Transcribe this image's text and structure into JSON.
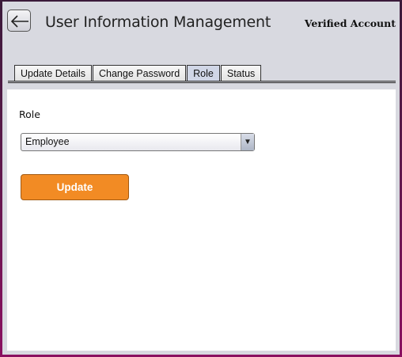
{
  "header": {
    "title": "User Information Management",
    "account_status": "Verified Account",
    "back_icon": "back-arrow-icon"
  },
  "tabs": [
    {
      "label": "Update Details",
      "active": false
    },
    {
      "label": "Change Password",
      "active": false
    },
    {
      "label": "Role",
      "active": true
    },
    {
      "label": "Status",
      "active": false
    }
  ],
  "role_panel": {
    "label": "Role",
    "selected_role": "Employee",
    "dropdown_icon": "chevron-down-icon",
    "update_label": "Update"
  },
  "colors": {
    "accent": "#f28b24",
    "window_bg": "#d8d9e0",
    "panel_bg": "#ffffff"
  }
}
